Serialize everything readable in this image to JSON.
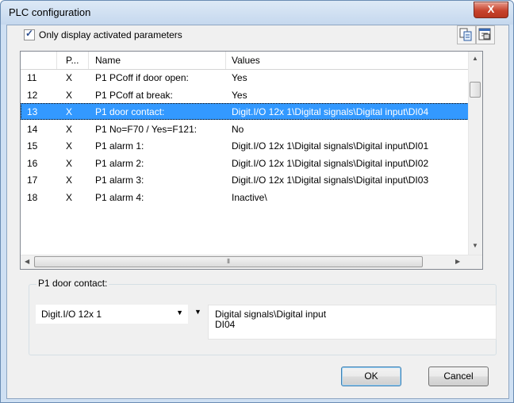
{
  "window": {
    "title": "PLC configuration",
    "close_label": "X"
  },
  "filter": {
    "checked": true,
    "label": "Only display activated parameters"
  },
  "toolbar": {
    "copy_icon": "copy-icon",
    "properties_icon": "properties-icon"
  },
  "grid": {
    "columns": [
      "",
      "P...",
      "Name",
      "Values"
    ],
    "rows": [
      {
        "num": "11",
        "p": "X",
        "name": "P1 PCoff if door open:",
        "value": "Yes"
      },
      {
        "num": "12",
        "p": "X",
        "name": "P1 PCoff at break:",
        "value": "Yes"
      },
      {
        "num": "13",
        "p": "X",
        "name": "P1 door contact:",
        "value": "Digit.I/O 12x 1\\Digital signals\\Digital input\\DI04"
      },
      {
        "num": "14",
        "p": "X",
        "name": "P1 No=F70 / Yes=F121:",
        "value": "No"
      },
      {
        "num": "15",
        "p": "X",
        "name": "P1 alarm 1:",
        "value": "Digit.I/O 12x 1\\Digital signals\\Digital input\\DI01"
      },
      {
        "num": "16",
        "p": "X",
        "name": "P1 alarm 2:",
        "value": "Digit.I/O 12x 1\\Digital signals\\Digital input\\DI02"
      },
      {
        "num": "17",
        "p": "X",
        "name": "P1 alarm 3:",
        "value": "Digit.I/O 12x 1\\Digital signals\\Digital input\\DI03"
      },
      {
        "num": "18",
        "p": "X",
        "name": "P1 alarm 4:",
        "value": "Inactive\\"
      }
    ],
    "selected_index": 2
  },
  "detail": {
    "group_label": "P1 door contact:",
    "module": "Digit.I/O 12x 1",
    "path_line1": "Digital signals\\Digital input",
    "path_line2": "DI04"
  },
  "buttons": {
    "ok": "OK",
    "cancel": "Cancel"
  },
  "colors": {
    "selection": "#3399ff",
    "close": "#c7432d"
  }
}
